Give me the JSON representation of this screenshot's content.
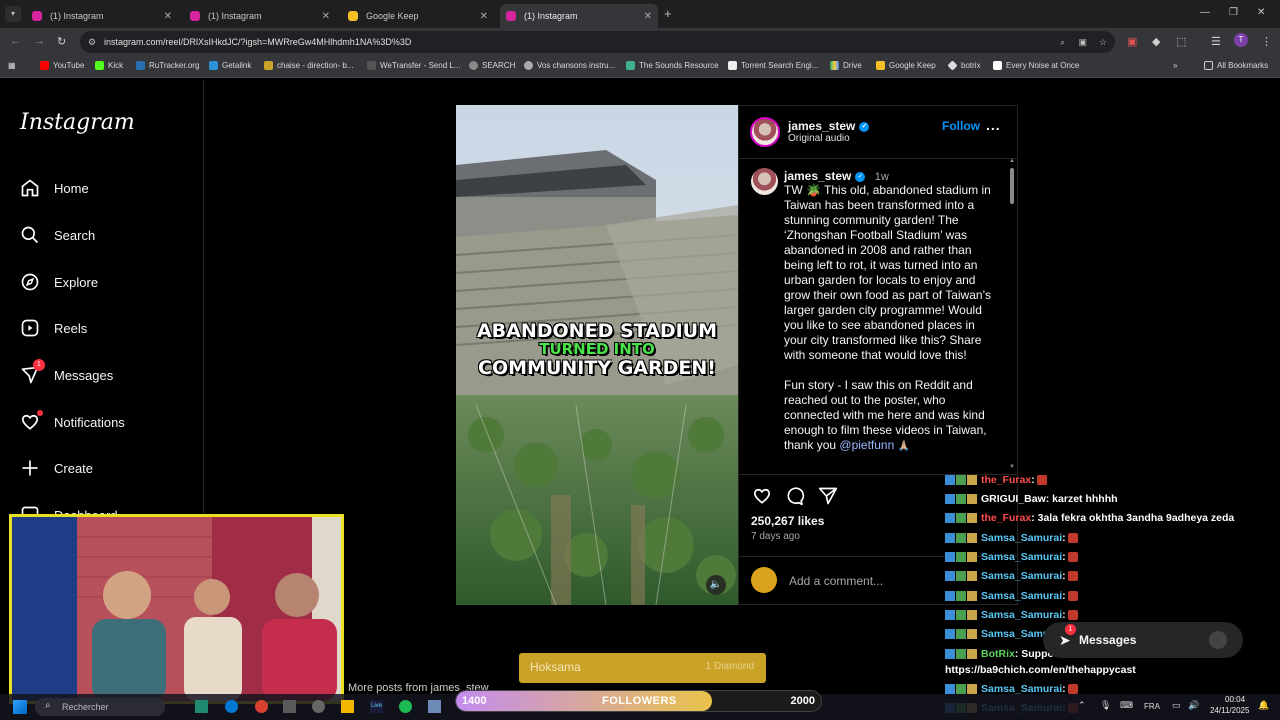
{
  "browser": {
    "tabs": [
      {
        "label": "(1) Instagram",
        "active": false
      },
      {
        "label": "(1) Instagram",
        "active": false
      },
      {
        "label": "Google Keep",
        "active": false
      },
      {
        "label": "(1) Instagram",
        "active": true
      }
    ],
    "url": "instagram.com/reel/DRlXsIHkdJC/?igsh=MWRreGw4MHlhdmh1NA%3D%3D",
    "bookmarks": [
      "YouTube",
      "Kick",
      "RuTracker.org",
      "Getalink",
      "chaise - direction- b...",
      "WeTransfer - Send L...",
      "SEARCH",
      "Vos chansons instru...",
      "The Sounds Resource",
      "Torrent Search Engi...",
      "Drive",
      "Google Keep",
      "botrix",
      "Every Noise at Once"
    ],
    "all_bookmarks": "All Bookmarks",
    "profile_initial": "T"
  },
  "sidebar": {
    "logo": "Instagram",
    "items": [
      {
        "label": "Home",
        "icon": "home-icon"
      },
      {
        "label": "Search",
        "icon": "search-icon"
      },
      {
        "label": "Explore",
        "icon": "compass-icon"
      },
      {
        "label": "Reels",
        "icon": "reels-icon"
      },
      {
        "label": "Messages",
        "icon": "messenger-icon",
        "badge": "1"
      },
      {
        "label": "Notifications",
        "icon": "heart-icon"
      },
      {
        "label": "Create",
        "icon": "plus-icon"
      },
      {
        "label": "Dashboard",
        "icon": "dashboard-icon"
      }
    ]
  },
  "post": {
    "overlay_line1": "ABANDONED STADIUM",
    "overlay_line2": "TURNED INTO",
    "overlay_line3": "COMMUNITY GARDEN!",
    "author": "james_stew",
    "audio": "Original audio",
    "follow": "Follow",
    "more": "...",
    "caption_author": "james_stew",
    "caption_time": "1w",
    "caption_p1": "TW 🪴 This old, abandoned stadium in Taiwan has been transformed into a stunning community garden! The ‘Zhongshan Football Stadium’ was abandoned in 2008 and rather than being left to rot, it was turned into an urban garden for locals to enjoy and grow their own food as part of Taiwan’s larger garden city programme! Would you like to see abandoned places in your city transformed like this? Share with someone that would love this!",
    "caption_p2": "Fun story - I saw this on Reddit and reached out to the poster, who connected with me here and was kind enough to film these videos in Taiwan, thank you",
    "caption_mention": "@pietfunn",
    "likes": "250,267 likes",
    "date": "7 days ago",
    "comment_placeholder": "Add a comment..."
  },
  "chat": {
    "lines": [
      {
        "user": "the_Furax",
        "user_color": "#ff4d4d",
        "msg": ":"
      },
      {
        "user": "GRIGUI_Baw",
        "user_color": "#ffffff",
        "msg": ": karzet hhhhh"
      },
      {
        "user": "the_Furax",
        "user_color": "#ff4d4d",
        "msg": ": 3ala fekra okhtha 3andha 9adheya zeda"
      },
      {
        "user": "Samsa_Samurai",
        "user_color": "#5bc8f5",
        "msg": ":"
      },
      {
        "user": "Samsa_Samurai",
        "user_color": "#5bc8f5",
        "msg": ":"
      },
      {
        "user": "Samsa_Samurai",
        "user_color": "#5bc8f5",
        "msg": ":"
      },
      {
        "user": "Samsa_Samurai",
        "user_color": "#5bc8f5",
        "msg": ":"
      },
      {
        "user": "Samsa_Samurai",
        "user_color": "#5bc8f5",
        "msg": ":"
      },
      {
        "user": "Samsa_Samurai",
        "user_color": "#5bc8f5",
        "msg": ":"
      },
      {
        "user": "BotRix",
        "user_color": "#5fd35f",
        "msg": ": Support Us On Bakchich"
      },
      {
        "user": "",
        "user_color": "#ffffff",
        "msg": "https://ba9chich.com/en/thehappycast"
      },
      {
        "user": "Samsa_Samurai",
        "user_color": "#5bc8f5",
        "msg": ":"
      },
      {
        "user": "Samsa_Samurai",
        "user_color": "#5bc8f5",
        "msg": ":"
      }
    ],
    "messages_label": "Messages",
    "messages_badge": "1"
  },
  "overlays": {
    "donor_name": "Hoksama",
    "donor_amount": "1 Diamond",
    "followers_label": "FOLLOWERS",
    "followers_current": "1400",
    "followers_goal": "2000",
    "followers_progress": 0.7,
    "more_posts": "More posts from james_stew"
  },
  "taskbar": {
    "search": "Rechercher",
    "lang": "FRA",
    "time": "00:04",
    "date": "24/11/2025"
  }
}
